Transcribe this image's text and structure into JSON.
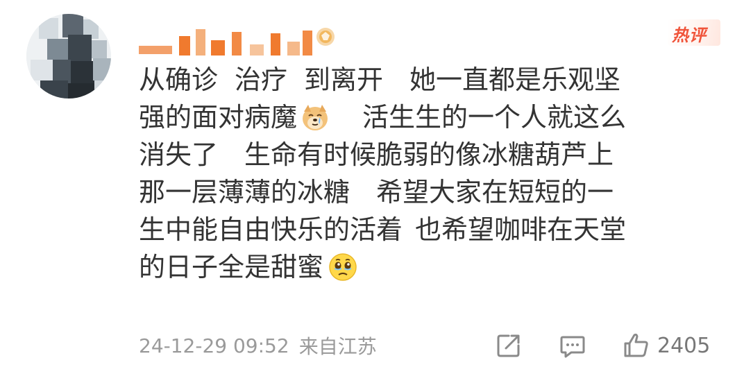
{
  "comment": {
    "hot_label": "热评",
    "lines": [
      [
        "从确诊",
        "治疗",
        "到离开",
        "她一直都是乐观坚"
      ],
      [
        "强的面对病魔",
        "活生生的一个人就这么"
      ],
      [
        "消失了",
        "生命有时候脆弱的像冰糖葫芦上"
      ],
      [
        "那一层薄薄的冰糖",
        "希望大家在短短的一"
      ],
      [
        "生中能自由快乐的活着",
        "也希望咖啡在天堂"
      ],
      [
        "的日子全是甜蜜"
      ]
    ],
    "emojis": {
      "after_line2": "crying-dog-emoji",
      "after_line6": "teary-face-emoji"
    },
    "timestamp": "24-12-29 09:52",
    "location": "来自江苏",
    "like_count": "2405"
  },
  "colors": {
    "text": "#333333",
    "meta": "#9a9a9a",
    "hot": "#f0543a",
    "username_orange": "#f07a2e"
  },
  "icons": {
    "share": "share-icon",
    "reply": "comment-icon",
    "like": "thumbs-up-icon"
  }
}
